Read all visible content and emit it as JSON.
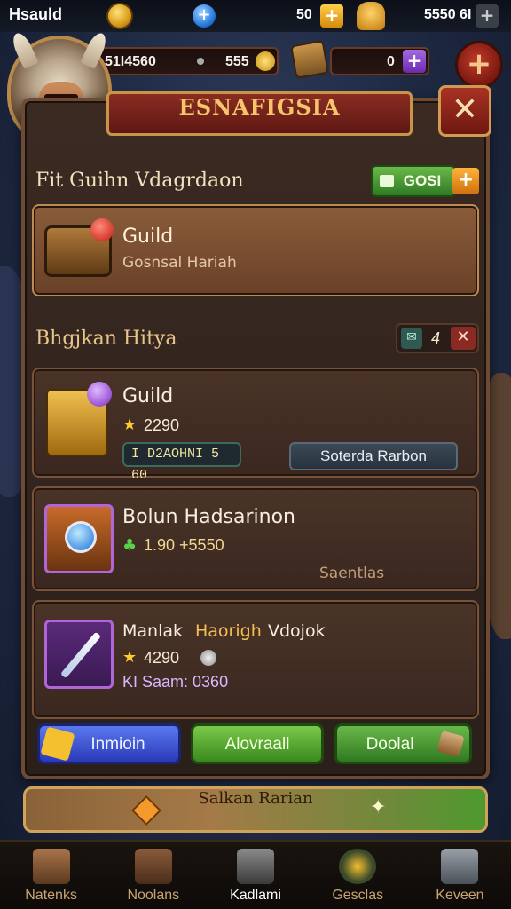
{
  "colors": {
    "panel": "#3a2a22",
    "accent_gold": "#f4c56a",
    "green": "#4e9a2e",
    "red": "#a83224",
    "blue": "#3a4fd8"
  },
  "status_bar": {
    "player_name": "Hsauld",
    "gold_value": "50",
    "currency_value": "5550 6I"
  },
  "resources": {
    "left_value": "51I4560",
    "middle_value": "555",
    "right_value": "0"
  },
  "dialog": {
    "title": "ESNAFIGSIA",
    "close_icon": "close-icon"
  },
  "guild_section": {
    "title": "Fit Guihn Vdagrdaon",
    "button_label": "GOSI",
    "featured": {
      "title": "Guild",
      "subtitle": "Gosnsal Hariah"
    }
  },
  "history_section": {
    "title": "Bhgjkan Hitya",
    "counter": "4",
    "items": [
      {
        "title": "Guild",
        "stat": "2290",
        "tag": "I D2AOHNI 5 60",
        "button": "Soterda Rarbon",
        "icon": "treasure-icon"
      },
      {
        "title": "Bolun Hadsarinon",
        "stat": "1.90 +5550",
        "side_text": "Saentlas",
        "icon": "orb-icon"
      },
      {
        "title_part1": "Manlak",
        "title_part2": "Haorigh",
        "title_part3": "Vdojok",
        "stat": "4290",
        "sub_stat": "KI Saam: 0360",
        "icon": "dagger-icon"
      }
    ]
  },
  "actions": {
    "blue_label": "Inmioin",
    "green_label": "Alovraall",
    "dark_green_label": "Doolal"
  },
  "bottom_banner": "Salkan Rarian",
  "nav": [
    {
      "label": "Natenks",
      "icon": "house-icon",
      "active": false
    },
    {
      "label": "Noolans",
      "icon": "tower-icon",
      "active": false
    },
    {
      "label": "Kadlami",
      "icon": "anvil-icon",
      "active": true
    },
    {
      "label": "Gesclas",
      "icon": "compass-icon",
      "active": false
    },
    {
      "label": "Keveen",
      "icon": "chest-icon",
      "active": false
    }
  ]
}
